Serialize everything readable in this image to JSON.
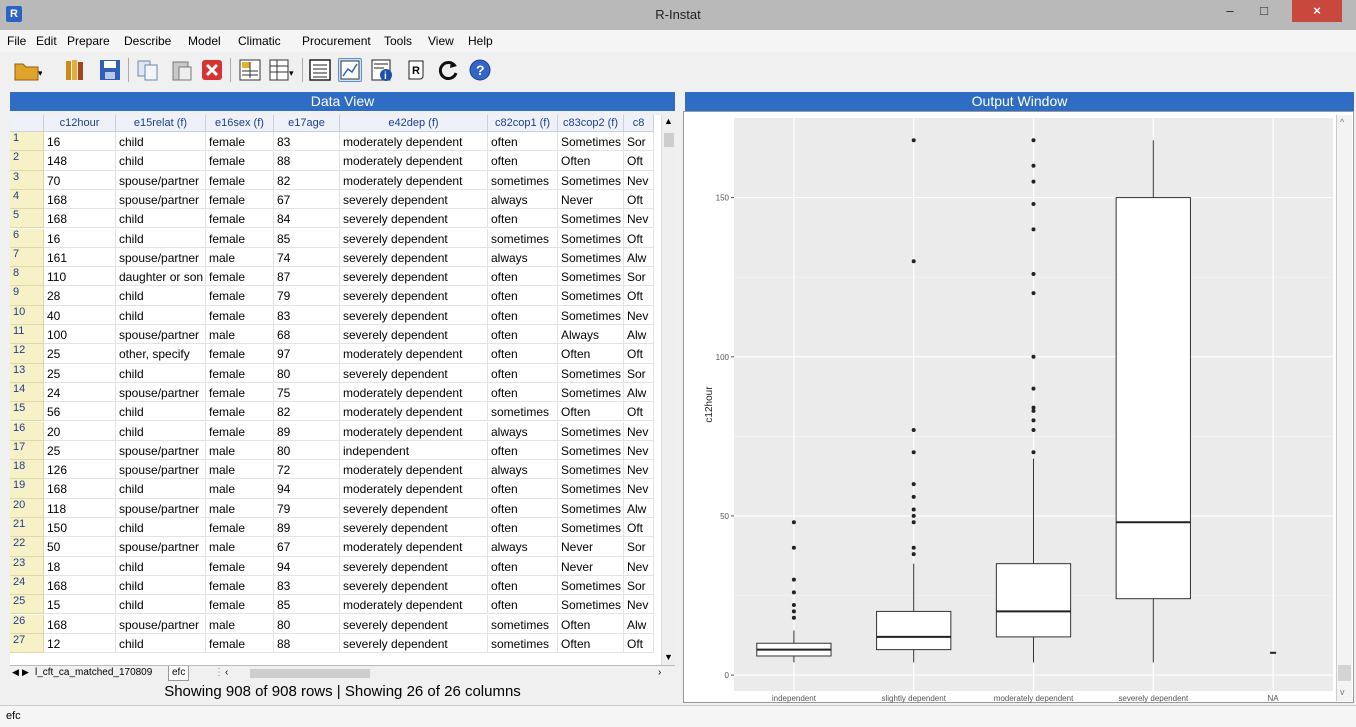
{
  "window": {
    "title": "R-Instat",
    "minimize": "–",
    "maximize": "□",
    "close": "×",
    "icon_letter": "R"
  },
  "menu": [
    "File",
    "Edit",
    "Prepare",
    "Describe",
    "Model",
    "Climatic",
    "Procurement",
    "Tools",
    "View",
    "Help"
  ],
  "toolbar_icons": [
    "open-folder-icon",
    "library-icon",
    "save-icon",
    "copy-icon",
    "paste-icon",
    "delete-icon",
    "data-view-icon",
    "column-metadata-icon",
    "log-icon",
    "output-graph-icon",
    "info-icon",
    "script-icon",
    "refresh-icon",
    "help-icon"
  ],
  "data_view": {
    "header": "Data View",
    "columns": [
      "c12hour",
      "e15relat (f)",
      "e16sex (f)",
      "e17age",
      "e42dep (f)",
      "c82cop1 (f)",
      "c83cop2 (f)",
      "c8"
    ],
    "rows": [
      [
        "1",
        "16",
        "child",
        "female",
        "83",
        "moderately dependent",
        "often",
        "Sometimes",
        "Sor"
      ],
      [
        "2",
        "148",
        "child",
        "female",
        "88",
        "moderately dependent",
        "often",
        "Often",
        "Oft"
      ],
      [
        "3",
        "70",
        "spouse/partner",
        "female",
        "82",
        "moderately dependent",
        "sometimes",
        "Sometimes",
        "Nev"
      ],
      [
        "4",
        "168",
        "spouse/partner",
        "female",
        "67",
        "severely dependent",
        "always",
        "Never",
        "Oft"
      ],
      [
        "5",
        "168",
        "child",
        "female",
        "84",
        "severely dependent",
        "often",
        "Sometimes",
        "Nev"
      ],
      [
        "6",
        "16",
        "child",
        "female",
        "85",
        "severely dependent",
        "sometimes",
        "Sometimes",
        "Oft"
      ],
      [
        "7",
        "161",
        "spouse/partner",
        "male",
        "74",
        "severely dependent",
        "always",
        "Sometimes",
        "Alw"
      ],
      [
        "8",
        "110",
        "daughter or son -",
        "female",
        "87",
        "severely dependent",
        "often",
        "Sometimes",
        "Sor"
      ],
      [
        "9",
        "28",
        "child",
        "female",
        "79",
        "severely dependent",
        "often",
        "Sometimes",
        "Oft"
      ],
      [
        "10",
        "40",
        "child",
        "female",
        "83",
        "severely dependent",
        "often",
        "Sometimes",
        "Nev"
      ],
      [
        "11",
        "100",
        "spouse/partner",
        "male",
        "68",
        "severely dependent",
        "often",
        "Always",
        "Alw"
      ],
      [
        "12",
        "25",
        "other, specify",
        "female",
        "97",
        "moderately dependent",
        "often",
        "Often",
        "Oft"
      ],
      [
        "13",
        "25",
        "child",
        "female",
        "80",
        "severely dependent",
        "often",
        "Sometimes",
        "Sor"
      ],
      [
        "14",
        "24",
        "spouse/partner",
        "female",
        "75",
        "moderately dependent",
        "often",
        "Sometimes",
        "Alw"
      ],
      [
        "15",
        "56",
        "child",
        "female",
        "82",
        "moderately dependent",
        "sometimes",
        "Often",
        "Oft"
      ],
      [
        "16",
        "20",
        "child",
        "female",
        "89",
        "moderately dependent",
        "always",
        "Sometimes",
        "Nev"
      ],
      [
        "17",
        "25",
        "spouse/partner",
        "male",
        "80",
        "independent",
        "often",
        "Sometimes",
        "Nev"
      ],
      [
        "18",
        "126",
        "spouse/partner",
        "male",
        "72",
        "moderately dependent",
        "always",
        "Sometimes",
        "Nev"
      ],
      [
        "19",
        "168",
        "child",
        "male",
        "94",
        "moderately dependent",
        "often",
        "Sometimes",
        "Nev"
      ],
      [
        "20",
        "118",
        "spouse/partner",
        "male",
        "79",
        "severely dependent",
        "often",
        "Sometimes",
        "Alw"
      ],
      [
        "21",
        "150",
        "child",
        "female",
        "89",
        "severely dependent",
        "often",
        "Sometimes",
        "Oft"
      ],
      [
        "22",
        "50",
        "spouse/partner",
        "male",
        "67",
        "moderately dependent",
        "always",
        "Never",
        "Sor"
      ],
      [
        "23",
        "18",
        "child",
        "female",
        "94",
        "severely dependent",
        "often",
        "Never",
        "Nev"
      ],
      [
        "24",
        "168",
        "child",
        "female",
        "83",
        "severely dependent",
        "often",
        "Sometimes",
        "Sor"
      ],
      [
        "25",
        "15",
        "child",
        "female",
        "85",
        "moderately dependent",
        "often",
        "Sometimes",
        "Nev"
      ],
      [
        "26",
        "168",
        "spouse/partner",
        "male",
        "80",
        "severely dependent",
        "sometimes",
        "Often",
        "Alw"
      ],
      [
        "27",
        "12",
        "child",
        "female",
        "88",
        "severely dependent",
        "sometimes",
        "Often",
        "Oft"
      ]
    ],
    "sheet_tabs": [
      "l_cft_ca_matched_170809",
      "efc"
    ],
    "status": "Showing 908 of 908 rows | Showing 26 of 26 columns"
  },
  "output": {
    "header": "Output Window"
  },
  "chart_data": {
    "type": "boxplot",
    "ylabel": "c12hour",
    "xlabel": "",
    "categories": [
      "independent",
      "slightly dependent",
      "moderately dependent",
      "severely dependent",
      "NA"
    ],
    "y_ticks": [
      "0",
      "50",
      "100",
      "150"
    ],
    "ylim": [
      -5,
      175
    ],
    "boxes": [
      {
        "q1": 6,
        "median": 8,
        "q3": 10,
        "whisker_low": 4,
        "whisker_high": 14,
        "outliers": [
          18,
          20,
          22,
          26,
          30,
          40,
          48
        ]
      },
      {
        "q1": 8,
        "median": 12,
        "q3": 20,
        "whisker_low": 4,
        "whisker_high": 35,
        "outliers": [
          38,
          40,
          48,
          50,
          52,
          56,
          60,
          70,
          77,
          130,
          168
        ]
      },
      {
        "q1": 12,
        "median": 20,
        "q3": 35,
        "whisker_low": 4,
        "whisker_high": 68,
        "outliers": [
          70,
          77,
          80,
          83,
          84,
          90,
          100,
          120,
          126,
          140,
          148,
          155,
          160,
          168
        ]
      },
      {
        "q1": 24,
        "median": 48,
        "q3": 150,
        "whisker_low": 4,
        "whisker_high": 168,
        "outliers": []
      },
      {
        "q1": 7,
        "median": 7,
        "q3": 7,
        "whisker_low": 7,
        "whisker_high": 7,
        "outliers": []
      }
    ],
    "grid": true,
    "background": "#ebebeb"
  },
  "status_bar": "efc"
}
